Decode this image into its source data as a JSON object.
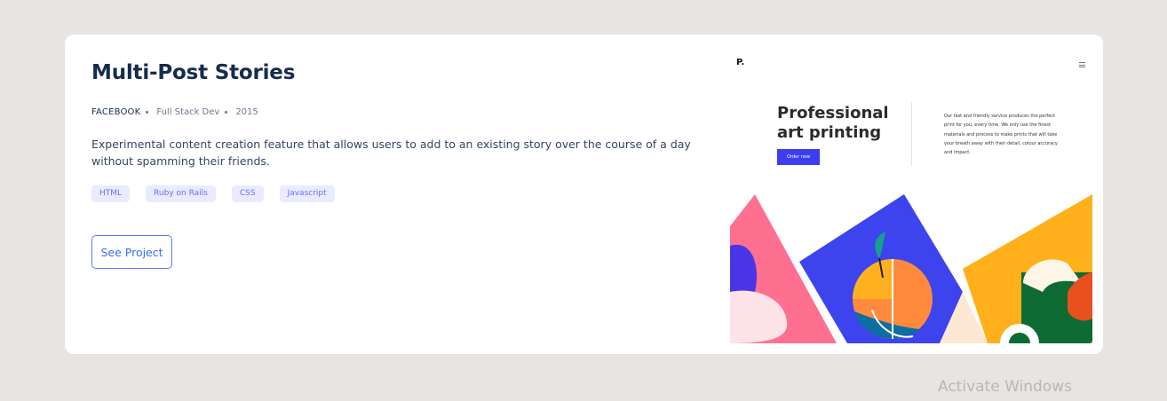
{
  "project": {
    "title": "Multi-Post Stories",
    "company": "FACEBOOK",
    "role": "Full Stack Dev",
    "year": "2015",
    "description": "Experimental content creation feature that allows users to add to an existing story over the course of a day without spamming their friends.",
    "tags": [
      "HTML",
      "Ruby on Rails",
      "CSS",
      "Javascript"
    ],
    "button_label": "See Project"
  },
  "preview": {
    "logo": "P.",
    "menu_icon": "hamburger-icon",
    "headline": "Professional art printing",
    "order_button": "Order now",
    "copy": "Our fast and friendly service produces the perfect print for you, every time. We only use the finest materials and process to make prints that will take your breath away with their detail, colour accuracy and impact."
  },
  "watermark": "Activate Windows",
  "colors": {
    "page_bg": "#e7e4e2",
    "title": "#172b4d",
    "accent": "#6070ff",
    "tag_bg": "#ebebff",
    "button_text": "#396df2"
  }
}
